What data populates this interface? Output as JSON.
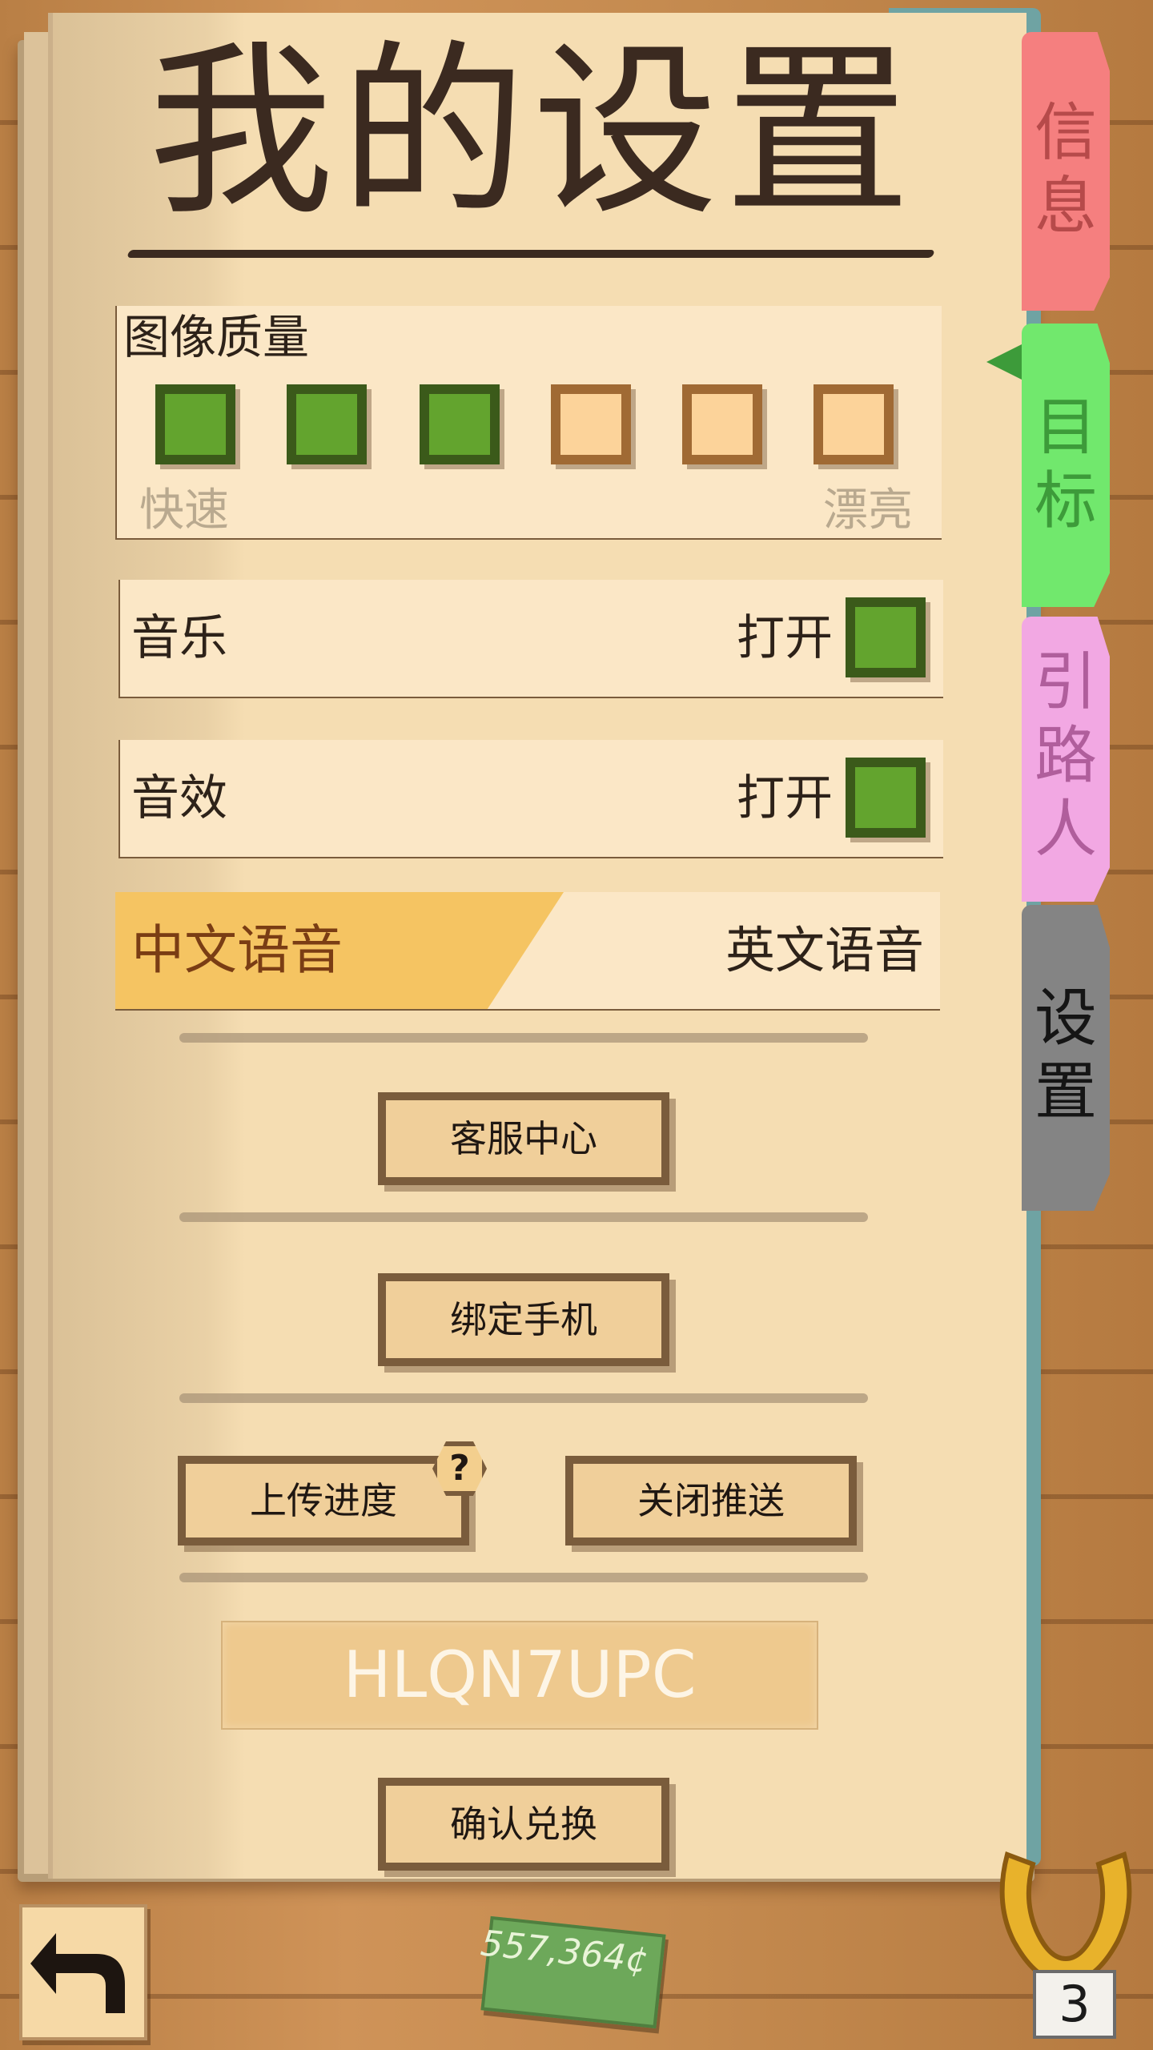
{
  "title": "我的设置",
  "quality": {
    "label": "图像质量",
    "levels": [
      {
        "state": "on"
      },
      {
        "state": "on"
      },
      {
        "state": "on"
      },
      {
        "state": "off"
      },
      {
        "state": "off"
      },
      {
        "state": "off"
      }
    ],
    "min_label": "快速",
    "max_label": "漂亮"
  },
  "music": {
    "label": "音乐",
    "state_label": "打开"
  },
  "sound": {
    "label": "音效",
    "state_label": "打开"
  },
  "language": {
    "chinese": "中文语音",
    "english": "英文语音",
    "selected": "chinese"
  },
  "buttons": {
    "support": "客服中心",
    "bind_phone": "绑定手机",
    "upload_progress": "上传进度",
    "help_badge": "?",
    "disable_push": "关闭推送",
    "confirm_redeem": "确认兑换"
  },
  "redeem": {
    "code": "HLQN7UPC"
  },
  "tabs": {
    "info": "信息",
    "goal": "目标",
    "guide": "引路人",
    "settings": "设置"
  },
  "tab_lines": {
    "info": [
      "信",
      "息"
    ],
    "goal": [
      "目",
      "标"
    ],
    "guide": [
      "引",
      "路",
      "人"
    ],
    "settings": [
      "设",
      "置"
    ]
  },
  "footer": {
    "money": "557,364¢",
    "horseshoe_count": "3"
  },
  "colors": {
    "accent_green": "#63a42e",
    "accent_orange": "#f5c462",
    "tab_info": "#f57f7f",
    "tab_goal": "#71e86d",
    "tab_guide": "#f2a8e3",
    "tab_settings": "#848484"
  },
  "icons": {
    "back": "back-arrow-icon",
    "horseshoe": "horseshoe-icon",
    "money": "cash-icon"
  }
}
